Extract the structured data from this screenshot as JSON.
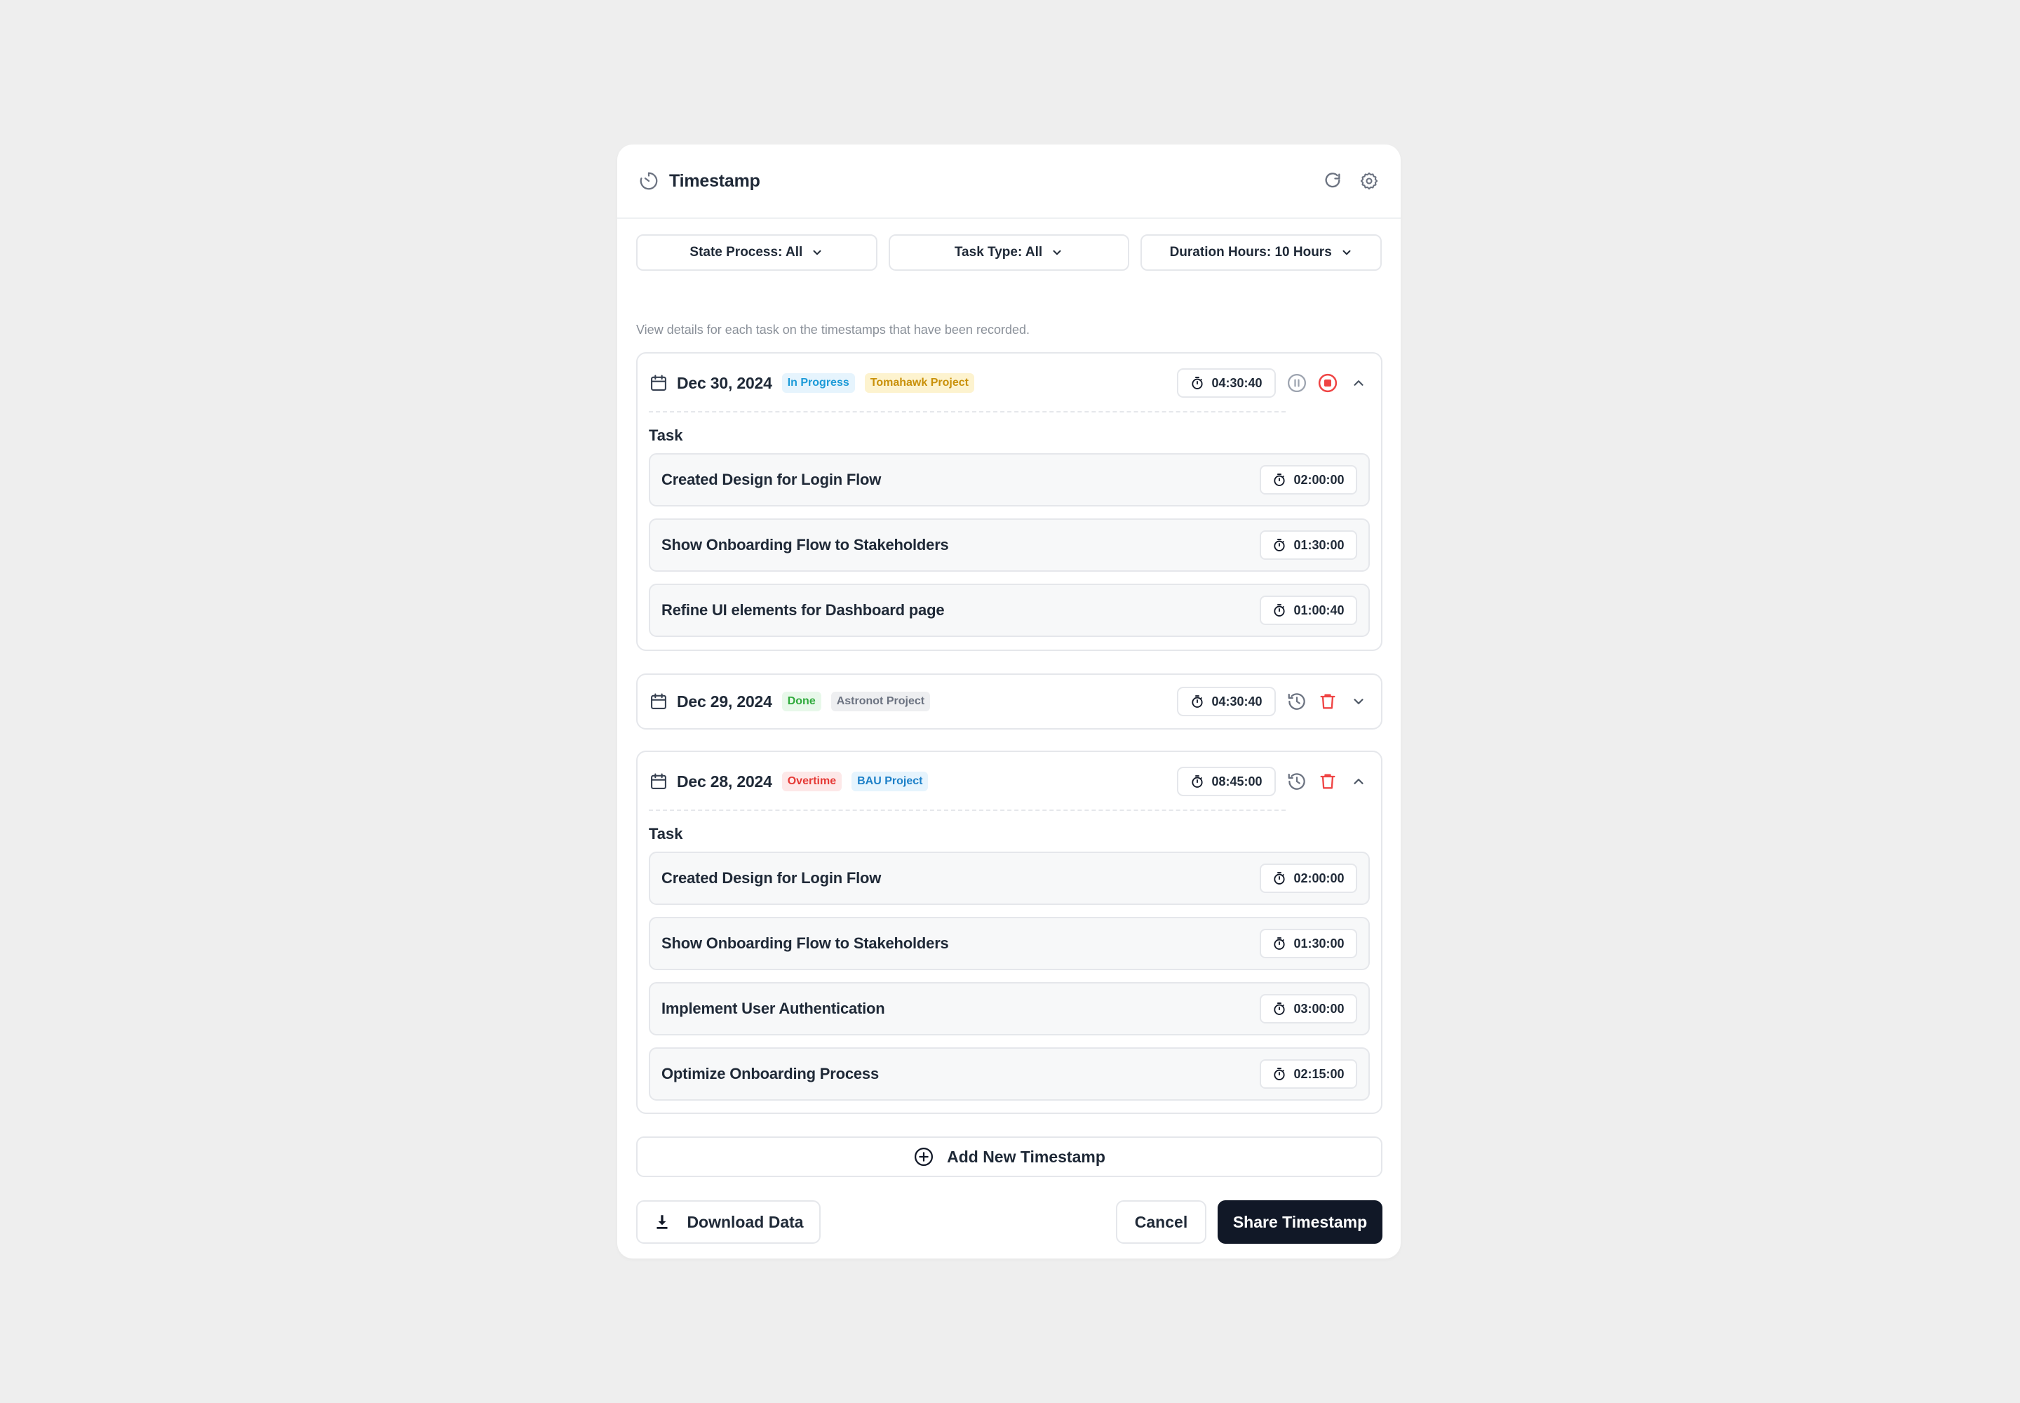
{
  "header": {
    "title": "Timestamp"
  },
  "filters": {
    "state_process": "State Process: All",
    "task_type": "Task Type: All",
    "duration_hours": "Duration Hours: 10 Hours"
  },
  "description": "View details for each task on the timestamps that have been recorded.",
  "groups": [
    {
      "date": "Dec 30, 2024",
      "status": "In Progress",
      "project": "Tomahawk Project",
      "total": "04:30:40",
      "task_label": "Task",
      "tasks": [
        {
          "name": "Created Design for Login Flow",
          "time": "02:00:00"
        },
        {
          "name": "Show Onboarding Flow to Stakeholders",
          "time": "01:30:00"
        },
        {
          "name": "Refine UI elements for Dashboard page",
          "time": "01:00:40"
        }
      ]
    },
    {
      "date": "Dec 29, 2024",
      "status": "Done",
      "project": "Astronot Project",
      "total": "04:30:40"
    },
    {
      "date": "Dec 28, 2024",
      "status": "Overtime",
      "project": "BAU Project",
      "total": "08:45:00",
      "task_label": "Task",
      "tasks": [
        {
          "name": "Created Design for Login Flow",
          "time": "02:00:00"
        },
        {
          "name": "Show Onboarding Flow to Stakeholders",
          "time": "01:30:00"
        },
        {
          "name": "Implement User Authentication",
          "time": "03:00:00"
        },
        {
          "name": "Optimize Onboarding Process",
          "time": "02:15:00"
        }
      ]
    }
  ],
  "actions": {
    "add_new": "Add New Timestamp",
    "download": "Download Data",
    "cancel": "Cancel",
    "share": "Share Timestamp"
  },
  "colors": {
    "in_progress_bg": "#e6f4fd",
    "in_progress_fg": "#1d9bd8",
    "tomahawk_bg": "#fdf3cf",
    "tomahawk_fg": "#c9910a",
    "done_bg": "#e8f8ea",
    "done_fg": "#2faa3c",
    "astronot_bg": "#eeeff1",
    "astronot_fg": "#6b7280",
    "overtime_bg": "#fde8e8",
    "overtime_fg": "#e53935",
    "bau_bg": "#e6f4fd",
    "bau_fg": "#1d80c8",
    "danger": "#ef4444",
    "primary": "#111827"
  }
}
